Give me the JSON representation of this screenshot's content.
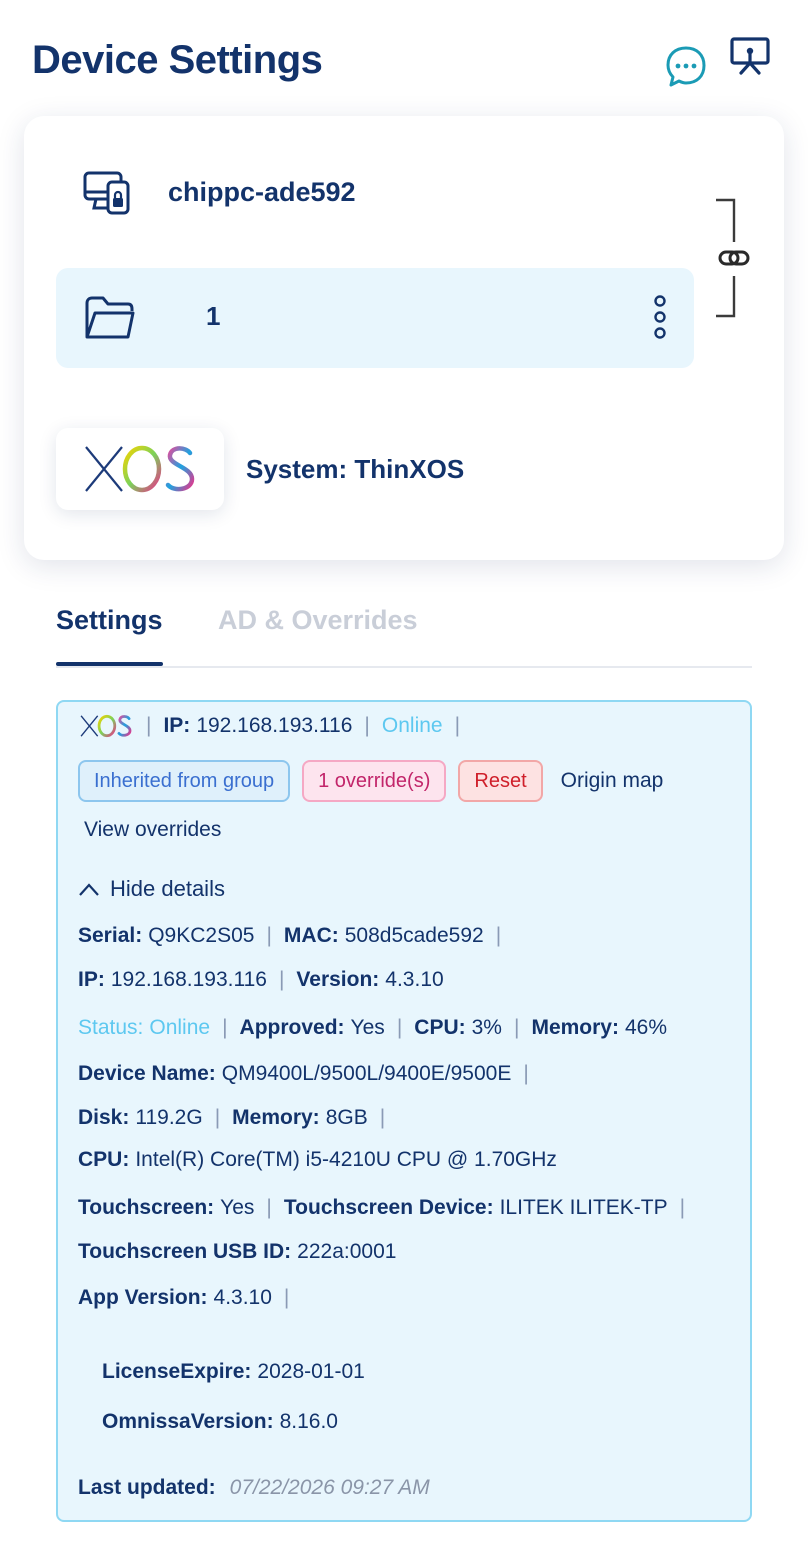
{
  "header": {
    "title": "Device Settings",
    "icons": [
      "chat-icon",
      "remote-display-icon"
    ]
  },
  "device": {
    "name": "chippc-ade592",
    "group_name": "1",
    "system_label": "System: ThinXOS",
    "os_logo_text": "XOS"
  },
  "tabs": [
    {
      "label": "Settings",
      "active": true
    },
    {
      "label": "AD & Overrides",
      "active": false
    }
  ],
  "details": {
    "top": {
      "logo_text": "XOS",
      "ip_label": "IP:",
      "ip_value": "192.168.193.116",
      "status": "Online"
    },
    "badges": {
      "inherited": "Inherited from group",
      "overrides": "1 override(s)",
      "reset": "Reset",
      "origin_map": "Origin map",
      "view_overrides": "View overrides"
    },
    "toggle_label": "Hide details",
    "serial_label": "Serial:",
    "serial_value": "Q9KC2S05",
    "mac_label": "MAC:",
    "mac_value": "508d5cade592",
    "ip_label": "IP:",
    "ip_value": "192.168.193.116",
    "version_label": "Version:",
    "version_value": "4.3.10",
    "status_label": "Status:",
    "status_value": "Online",
    "approved_label": "Approved:",
    "approved_value": "Yes",
    "cpu_usage_label": "CPU:",
    "cpu_usage_value": "3%",
    "memory_usage_label": "Memory:",
    "memory_usage_value": "46%",
    "device_name_label": "Device Name:",
    "device_name_value": "QM9400L/9500L/9400E/9500E",
    "disk_label": "Disk:",
    "disk_value": "119.2G",
    "memory_label": "Memory:",
    "memory_value": "8GB",
    "cpu_label": "CPU:",
    "cpu_value": "Intel(R) Core(TM) i5-4210U CPU @ 1.70GHz",
    "touchscreen_label": "Touchscreen:",
    "touchscreen_value": "Yes",
    "touch_device_label": "Touchscreen Device:",
    "touch_device_value": "ILITEK ILITEK-TP",
    "touch_usb_label": "Touchscreen USB ID:",
    "touch_usb_value": "222a:0001",
    "app_version_label": "App Version:",
    "app_version_value": "4.3.10",
    "license_label": "LicenseExpire:",
    "license_value": "2028-01-01",
    "omnissa_label": "OmnissaVersion:",
    "omnissa_value": "8.16.0",
    "last_updated_label": "Last updated:",
    "last_updated_value": "07/22/2026 09:27 AM"
  },
  "colors": {
    "primary": "#13336b",
    "accent": "#1b9bb5",
    "online": "#5dc8f0",
    "panel_bg": "#e8f6fd",
    "panel_border": "#8fd8f3"
  }
}
